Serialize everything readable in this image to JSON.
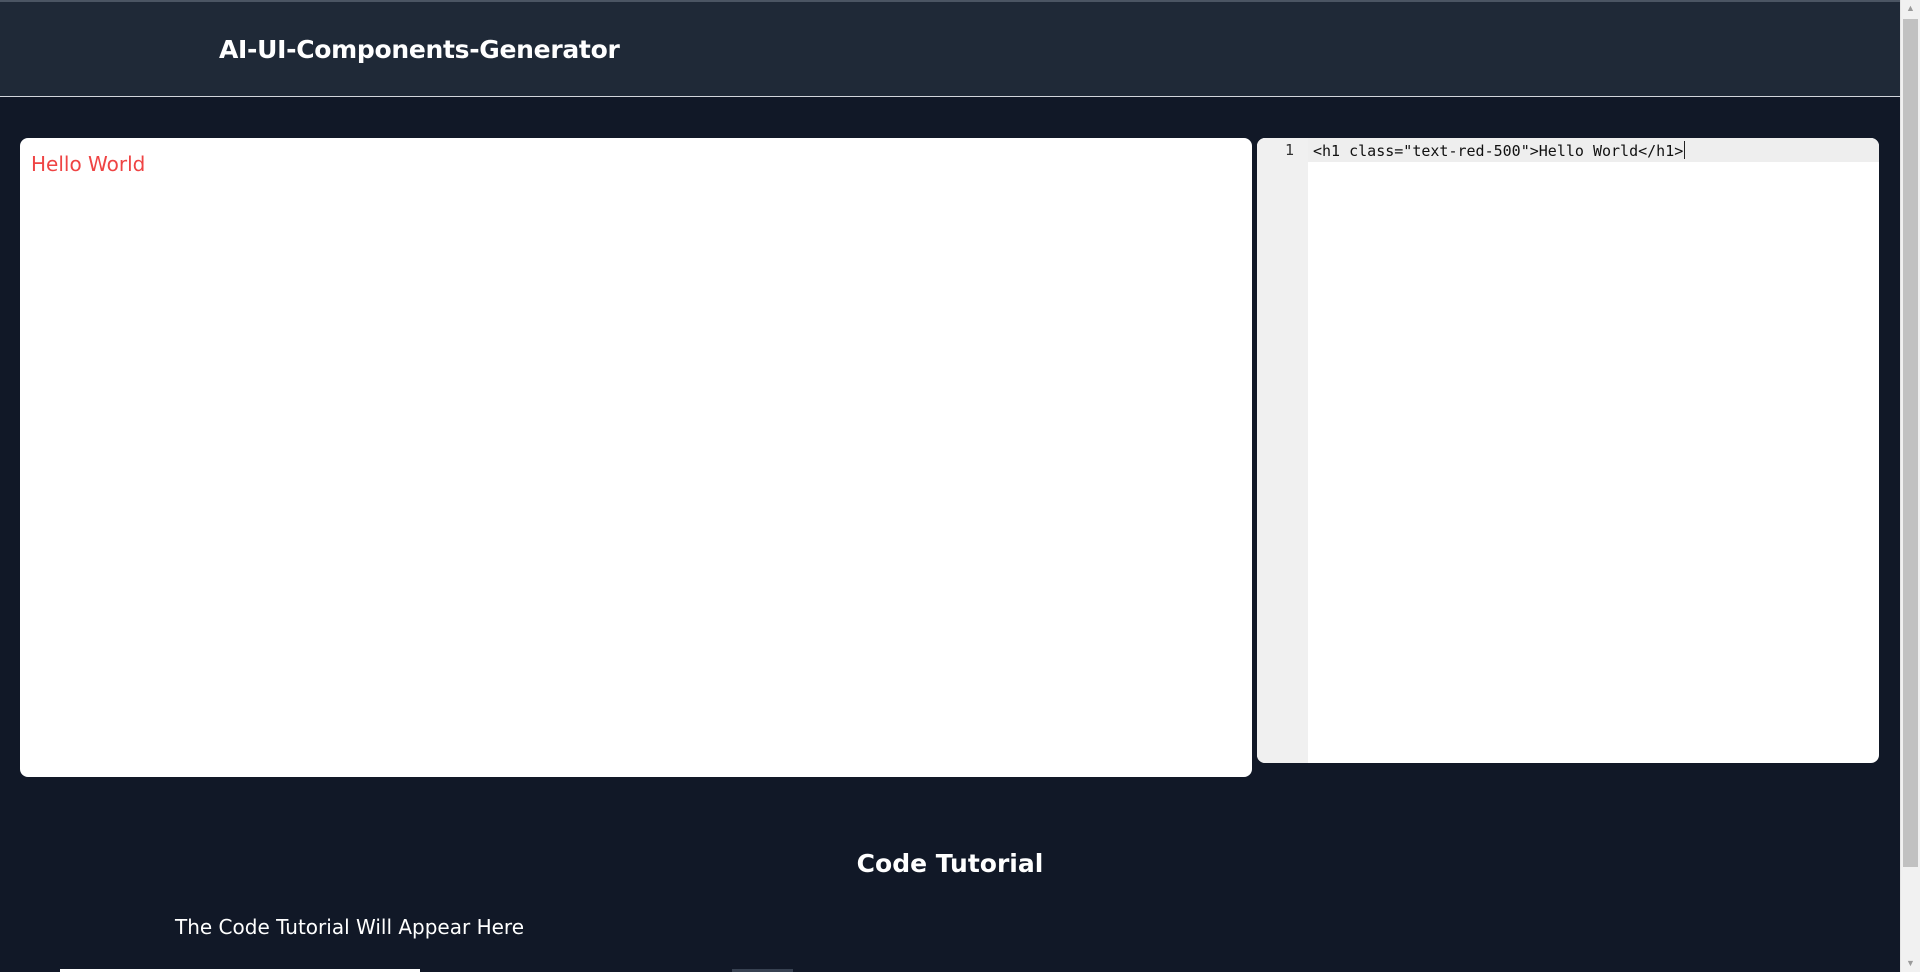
{
  "header": {
    "title": "AI-UI-Components-Generator"
  },
  "preview": {
    "heading_text": "Hello World",
    "heading_color": "#ef4444"
  },
  "editor": {
    "line_number": "1",
    "code": "<h1 class=\"text-red-500\">Hello World</h1>"
  },
  "tutorial": {
    "title": "Code Tutorial",
    "placeholder": "The Code Tutorial Will Appear Here"
  },
  "scrollbar": {
    "up_icon": "scroll-up-arrow",
    "down_icon": "scroll-down-arrow",
    "up_glyph": "▲",
    "down_glyph": "▼"
  },
  "theme": {
    "background": "#111827",
    "header_background": "#1f2937"
  }
}
